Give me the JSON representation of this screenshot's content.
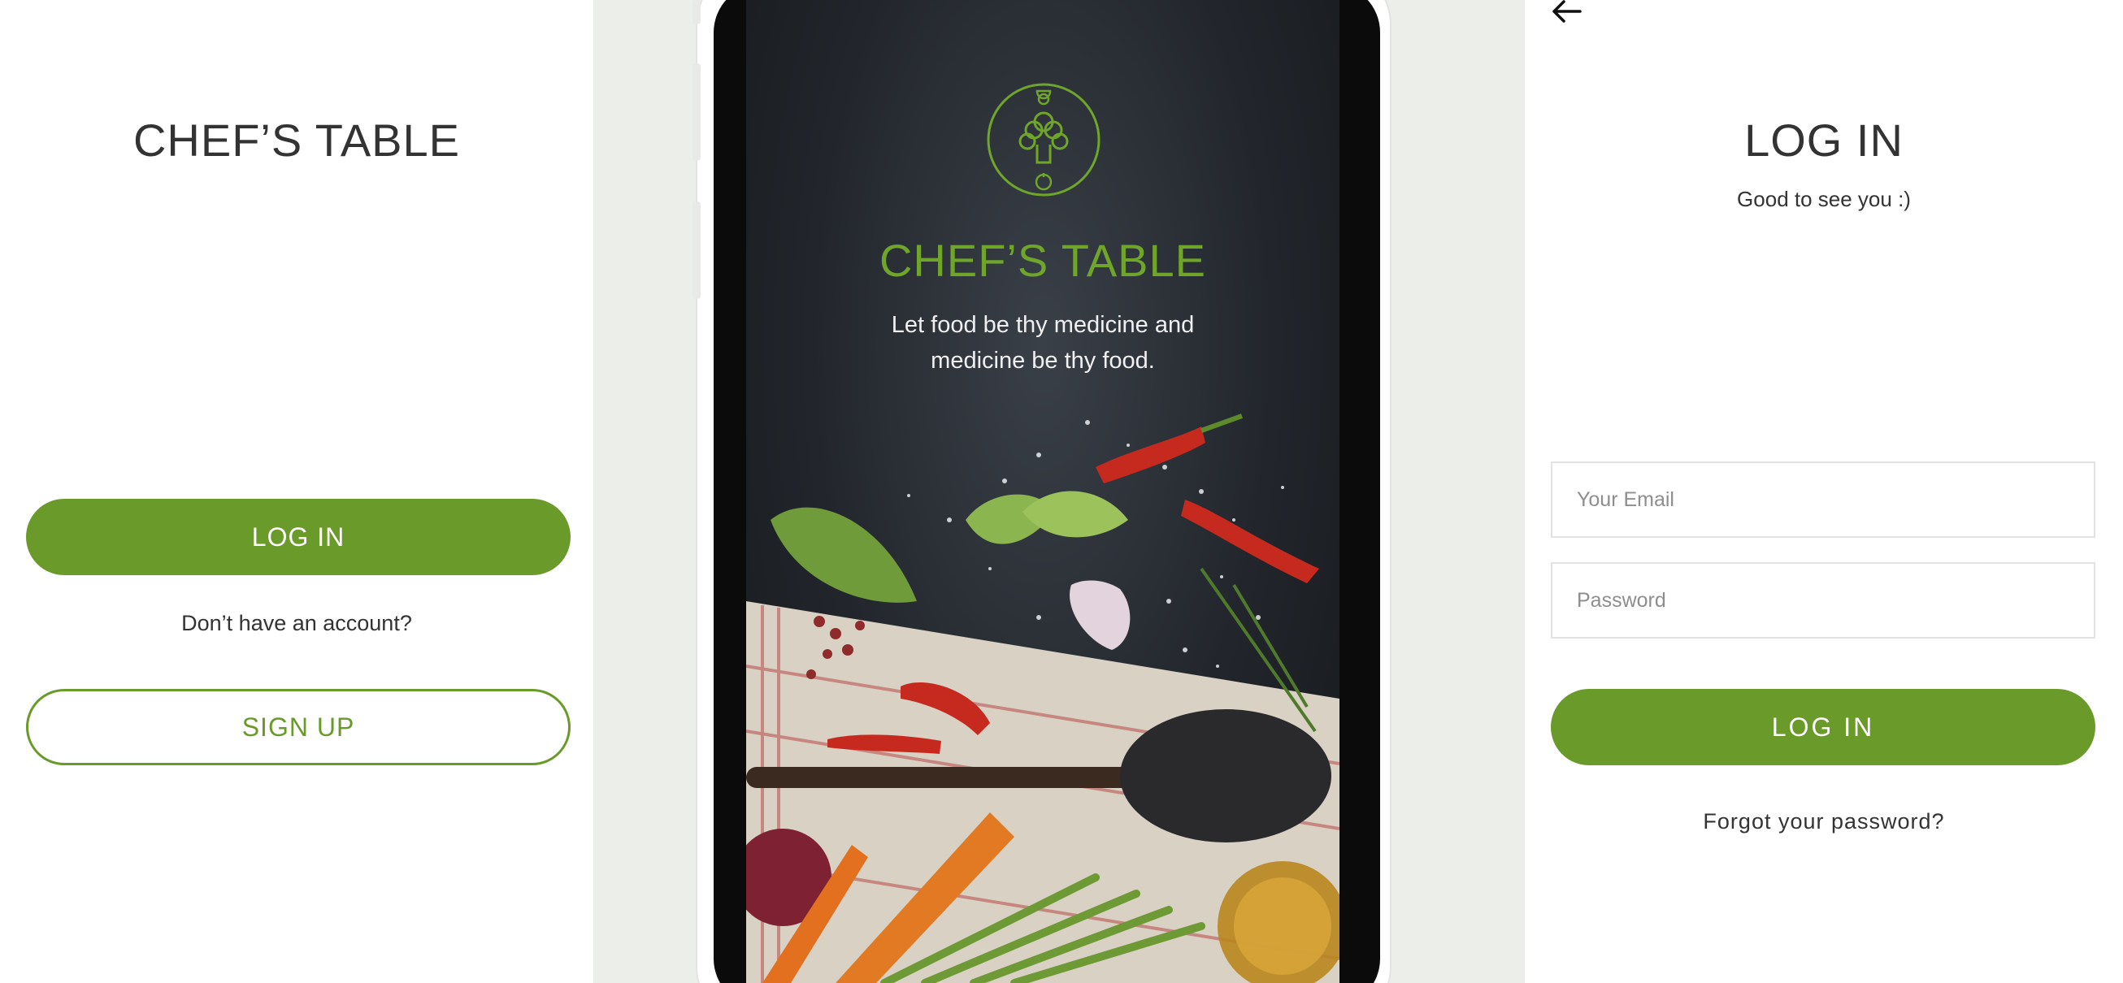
{
  "left_screen": {
    "title": "CHEF’S TABLE",
    "login_label": "LOG IN",
    "no_account_text": "Don’t have an account?",
    "signup_label": "SIGN UP"
  },
  "splash_screen": {
    "logo_icon": "chef-hat-icon",
    "title": "CHEF’S TABLE",
    "tagline_line1": "Let food be thy medicine and",
    "tagline_line2": "medicine be thy food."
  },
  "login_screen": {
    "back_icon": "arrow-left-icon",
    "title": "LOG IN",
    "subtitle": "Good to see you :)",
    "email_placeholder": "Your Email",
    "password_placeholder": "Password",
    "login_label": "LOG IN",
    "forgot_label": "Forgot your password?"
  },
  "colors": {
    "accent_green": "#6a9a2a",
    "splash_green": "#6fa52b",
    "text_dark": "#333333",
    "page_bg": "#eceee9"
  }
}
